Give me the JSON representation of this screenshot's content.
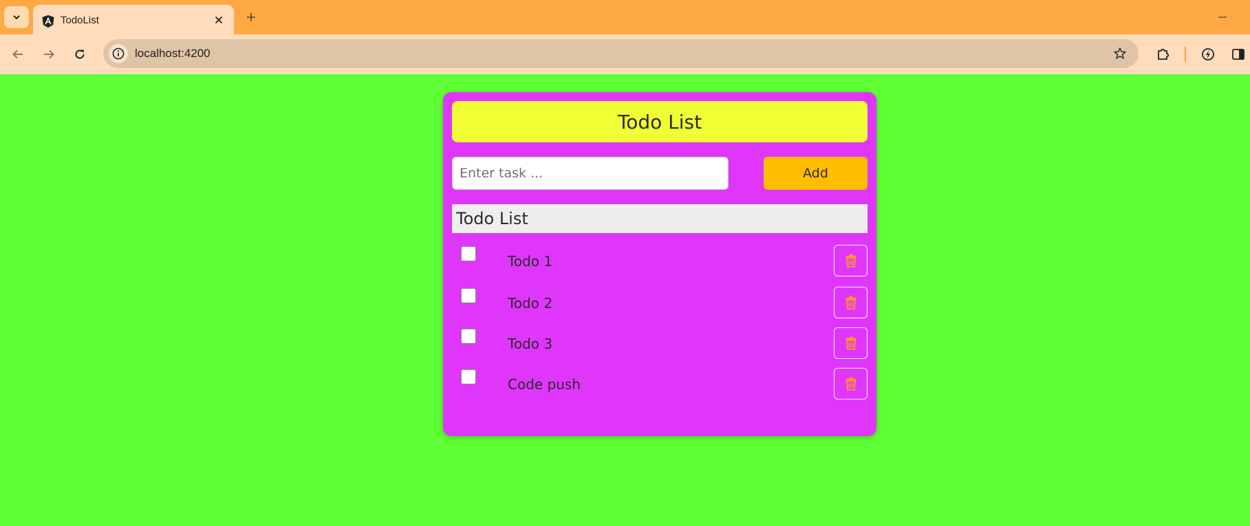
{
  "browser": {
    "tab": {
      "title": "TodoList",
      "favicon": "angular-icon",
      "close_icon": "close-icon"
    },
    "new_tab_icon": "plus-icon",
    "tab_list_icon": "chevron-down-icon",
    "minimize_icon": "minimize-icon",
    "toolbar": {
      "back_icon": "arrow-left-icon",
      "forward_icon": "arrow-right-icon",
      "reload_icon": "reload-icon",
      "site_info_icon": "info-icon",
      "url": "localhost:4200",
      "bookmark_icon": "star-icon",
      "extensions_icon": "puzzle-icon",
      "performance_icon": "leaf-speed-icon",
      "side_panel_icon": "side-panel-icon"
    },
    "colors": {
      "tabbar": "#ffa944",
      "toolbar": "#ffdcbc",
      "omnibox": "#e0c4a6"
    }
  },
  "app": {
    "colors": {
      "page_background": "#5fff35",
      "card": "#e036fb",
      "header": "#efff33",
      "add_button": "#ffbe00",
      "list_heading": "#eeeeee",
      "delete_icon": "#ff9f1a"
    },
    "header": {
      "title": "Todo List"
    },
    "form": {
      "input_value": "",
      "input_placeholder": "Enter task ...",
      "add_label": "Add"
    },
    "list": {
      "heading": "Todo List",
      "items": [
        {
          "text": "Todo 1",
          "checked": false,
          "delete_icon": "trash-icon"
        },
        {
          "text": "Todo 2",
          "checked": false,
          "delete_icon": "trash-icon"
        },
        {
          "text": "Todo 3",
          "checked": false,
          "delete_icon": "trash-icon"
        },
        {
          "text": "Code push",
          "checked": false,
          "delete_icon": "trash-icon"
        }
      ]
    }
  }
}
